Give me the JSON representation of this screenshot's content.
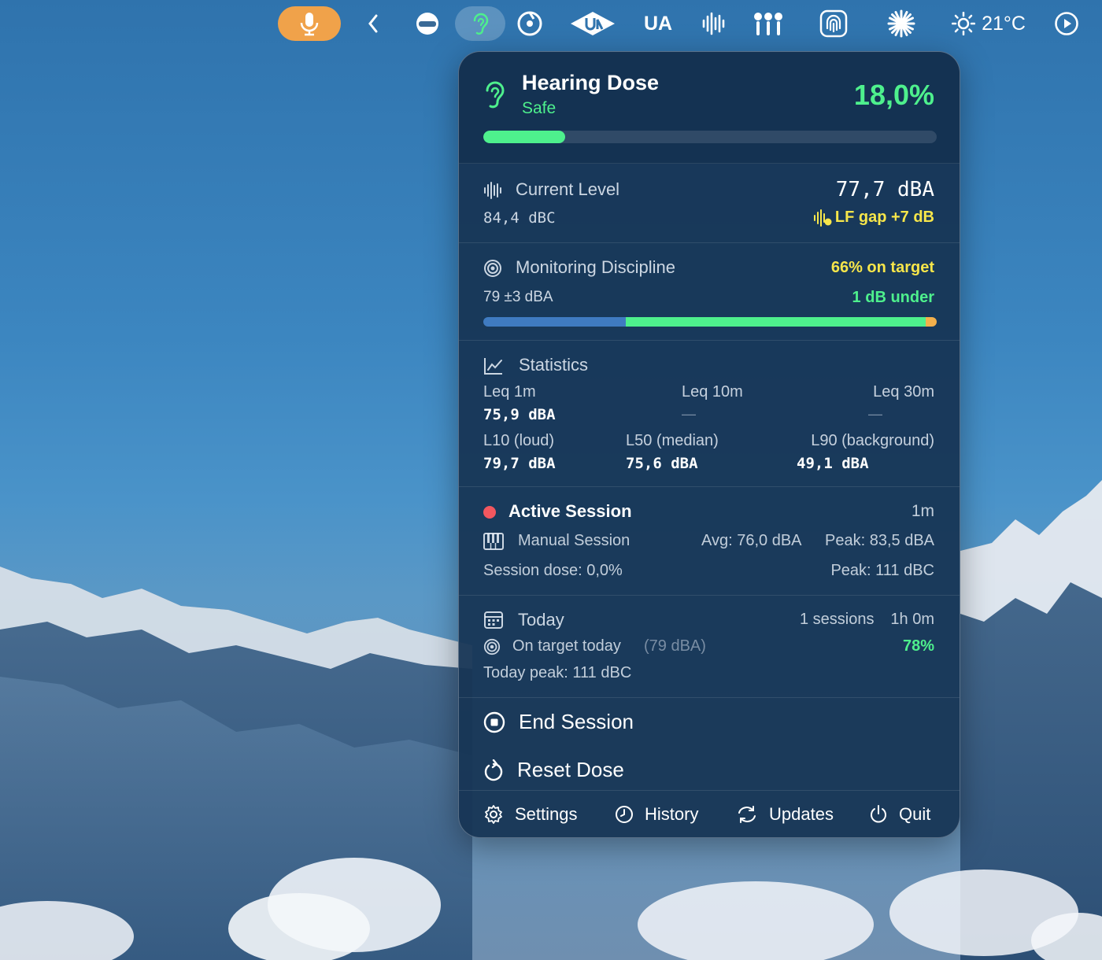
{
  "menubar": {
    "ua_label": "UA",
    "weather_temp": "21°C"
  },
  "hearing_dose": {
    "title": "Hearing Dose",
    "status": "Safe",
    "percent_label": "18,0%",
    "percent_value": 18.0
  },
  "current_level": {
    "label": "Current Level",
    "value_dba": "77,7 dBA",
    "value_dbc": "84,4 dBC",
    "lf_gap": "LF gap +7 dB"
  },
  "monitoring": {
    "label": "Monitoring Discipline",
    "target": "79 ±3 dBA",
    "on_target": "66% on target",
    "deviation": "1 dB under",
    "distribution": {
      "under_fraction": 0.315,
      "on_fraction": 0.66,
      "over_fraction": 0.025
    }
  },
  "statistics": {
    "label": "Statistics",
    "leq_1m_label": "Leq 1m",
    "leq_1m_value": "75,9 dBA",
    "leq_10m_label": "Leq 10m",
    "leq_10m_value": "—",
    "leq_30m_label": "Leq 30m",
    "leq_30m_value": "—",
    "l10_label": "L10 (loud)",
    "l10_value": "79,7 dBA",
    "l50_label": "L50 (median)",
    "l50_value": "75,6 dBA",
    "l90_label": "L90 (background)",
    "l90_value": "49,1 dBA"
  },
  "session": {
    "title": "Active Session",
    "duration": "1m",
    "type": "Manual Session",
    "avg": "Avg: 76,0 dBA",
    "peak_dba": "Peak: 83,5 dBA",
    "dose": "Session dose: 0,0%",
    "peak_dbc": "Peak: 111 dBC"
  },
  "today": {
    "label": "Today",
    "sessions": "1 sessions",
    "time": "1h 0m",
    "on_target_label": "On target today",
    "on_target_ref": "(79 dBA)",
    "on_target_pct": "78%",
    "peak": "Today peak: 111 dBC"
  },
  "actions": {
    "end_session": "End Session",
    "reset_dose": "Reset Dose"
  },
  "footer": {
    "settings": "Settings",
    "history": "History",
    "updates": "Updates",
    "quit": "Quit"
  },
  "colors": {
    "accent_green": "#4ef08d",
    "warning_yellow": "#f7e64a",
    "under_blue": "#3f7bc1",
    "over_orange": "#f3b04c",
    "record_red": "#f2575f",
    "mic_orange": "#f0a24a"
  }
}
